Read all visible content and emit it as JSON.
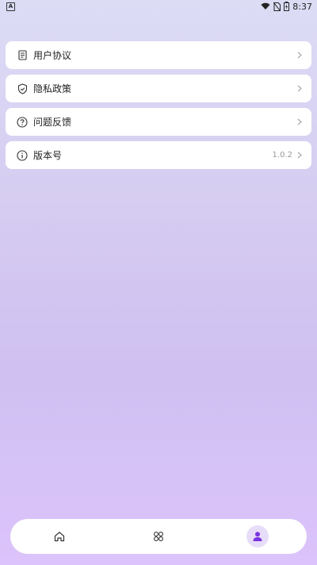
{
  "status": {
    "time": "8:37",
    "left_glyph": "A"
  },
  "menu": {
    "items": [
      {
        "label": "用户协议",
        "icon": "document-icon"
      },
      {
        "label": "隐私政策",
        "icon": "shield-icon"
      },
      {
        "label": "问题反馈",
        "icon": "question-icon"
      },
      {
        "label": "版本号",
        "icon": "info-icon",
        "value": "1.0.2"
      }
    ]
  },
  "tabs": [
    {
      "icon": "home-icon"
    },
    {
      "icon": "apps-grid-icon"
    },
    {
      "icon": "user-icon",
      "active": true
    }
  ],
  "colors": {
    "accent": "#7a35e0",
    "active_bg": "#e7dcf9"
  }
}
